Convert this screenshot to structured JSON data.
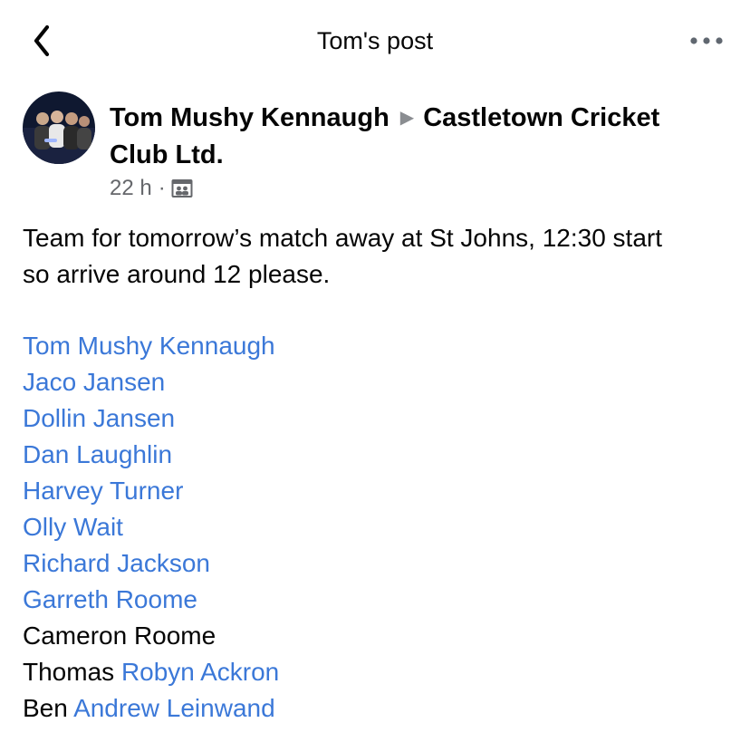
{
  "header": {
    "title": "Tom's post"
  },
  "post": {
    "author": "Tom Mushy Kennaugh",
    "group": "Castletown Cricket Club Ltd.",
    "time": "22 h",
    "audience_icon": "group-icon",
    "body_line1": "Team for tomorrow’s match away at St Johns, 12:30 start",
    "body_line2": "so arrive around 12 please.",
    "lineup": [
      {
        "mention": "Tom Mushy Kennaugh"
      },
      {
        "mention": "Jaco Jansen"
      },
      {
        "mention": "Dollin Jansen"
      },
      {
        "mention": "Dan Laughlin"
      },
      {
        "mention": "Harvey Turner"
      },
      {
        "mention": "Olly Wait"
      },
      {
        "mention": "Richard Jackson"
      },
      {
        "mention": "Garreth Roome"
      },
      {
        "plain": "Cameron Roome"
      },
      {
        "plain": "Thomas",
        "mention": "Robyn Ackron"
      },
      {
        "plain": "Ben",
        "mention": "Andrew Leinwand"
      }
    ]
  },
  "colors": {
    "mention": "#3b78d8",
    "text": "#050505",
    "meta": "#65676b"
  }
}
